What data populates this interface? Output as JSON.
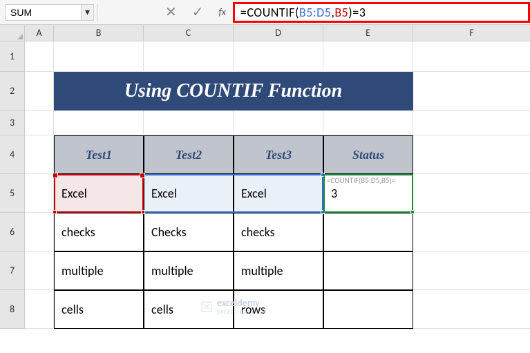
{
  "toolbar": {
    "namebox_value": "SUM",
    "cancel_icon": "✕",
    "confirm_icon": "✓",
    "fx_label": "fx",
    "formula": {
      "eq": "=",
      "fn": "COUNTIF",
      "open": "(",
      "range": "B5:D5",
      "comma": ",",
      "ref": "B5",
      "close": ")",
      "tail": "=3"
    }
  },
  "columns": {
    "A": "A",
    "B": "B",
    "C": "C",
    "D": "D",
    "E": "E",
    "F": "F"
  },
  "rows": {
    "r1": "1",
    "r2": "2",
    "r3": "3",
    "r4": "4",
    "r5": "5",
    "r6": "6",
    "r7": "7",
    "r8": "8"
  },
  "banner": "Using COUNTIF Function",
  "table": {
    "headers": [
      "Test1",
      "Test2",
      "Test3",
      "Status"
    ],
    "data": [
      [
        "Excel",
        "Excel",
        "Excel",
        "3"
      ],
      [
        "checks",
        "Checks",
        "checks",
        ""
      ],
      [
        "multiple",
        "multiple",
        "multiple",
        ""
      ],
      [
        "cells",
        "cells",
        "rows",
        ""
      ]
    ]
  },
  "active_cell_faint": "=COUNTIF(B5:D5,B5)=",
  "watermark": "exceldemy",
  "watermark_sub": "EXCEL · DATA · BI",
  "chevron": "▾"
}
